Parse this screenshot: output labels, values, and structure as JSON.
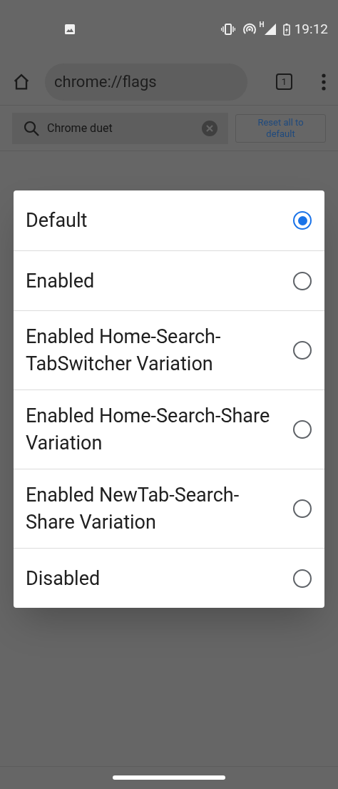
{
  "status_bar": {
    "time": "19:12",
    "network": "H"
  },
  "toolbar": {
    "url": "chrome://flags",
    "tab_count": "1"
  },
  "search": {
    "value": "Chrome duet",
    "reset_button": "Reset all to default"
  },
  "dialog": {
    "options": [
      {
        "label": "Default",
        "selected": true
      },
      {
        "label": "Enabled",
        "selected": false
      },
      {
        "label": "Enabled Home-Search-TabSwitcher Variation",
        "selected": false
      },
      {
        "label": "Enabled Home-Search-Share Variation",
        "selected": false
      },
      {
        "label": "Enabled NewTab-Search-Share Variation",
        "selected": false
      },
      {
        "label": "Disabled",
        "selected": false
      }
    ]
  }
}
